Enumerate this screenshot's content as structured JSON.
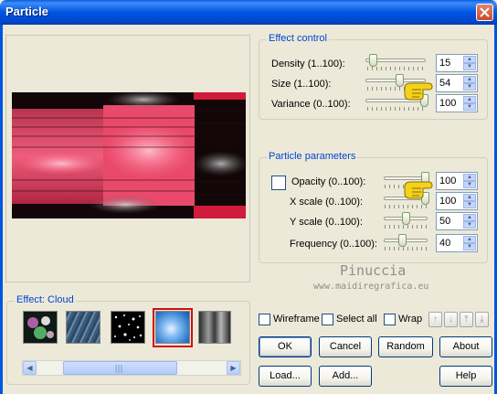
{
  "window": {
    "title": "Particle"
  },
  "effect_control": {
    "legend": "Effect control",
    "rows": [
      {
        "label": "Density (1..100):",
        "value": "15",
        "level": 15
      },
      {
        "label": "Size (1..100):",
        "value": "54",
        "level": 54
      },
      {
        "label": "Variance (0..100):",
        "value": "100",
        "level": 100
      }
    ]
  },
  "particle_parameters": {
    "legend": "Particle parameters",
    "rows": [
      {
        "label": "Opacity (0..100):",
        "value": "100",
        "level": 100
      },
      {
        "label": "X scale (0..100):",
        "value": "100",
        "level": 100
      },
      {
        "label": "Y scale (0..100):",
        "value": "50",
        "level": 50
      },
      {
        "label": "Frequency (0..100):",
        "value": "40",
        "level": 40
      }
    ]
  },
  "effect_group": {
    "legend": "Effect: Cloud",
    "thumbnails": [
      "bubbles",
      "water",
      "stars",
      "cloud",
      "smoke"
    ],
    "selected": "cloud",
    "scroll_position": 0.45
  },
  "watermark": {
    "line1": "Pinuccia",
    "line2": "www.maidiregrafica.eu"
  },
  "options": {
    "wireframe": "Wireframe",
    "select_all": "Select all",
    "wrap": "Wrap"
  },
  "buttons": {
    "ok": "OK",
    "cancel": "Cancel",
    "random": "Random",
    "about": "About",
    "load": "Load...",
    "add": "Add...",
    "help": "Help"
  },
  "arrow_buttons": [
    "up-icon",
    "down-icon",
    "to-top-icon",
    "to-bottom-icon"
  ],
  "colors": {
    "title_bar": "#0054e3",
    "group_label": "#0046d5",
    "selected_border": "#d01010"
  }
}
